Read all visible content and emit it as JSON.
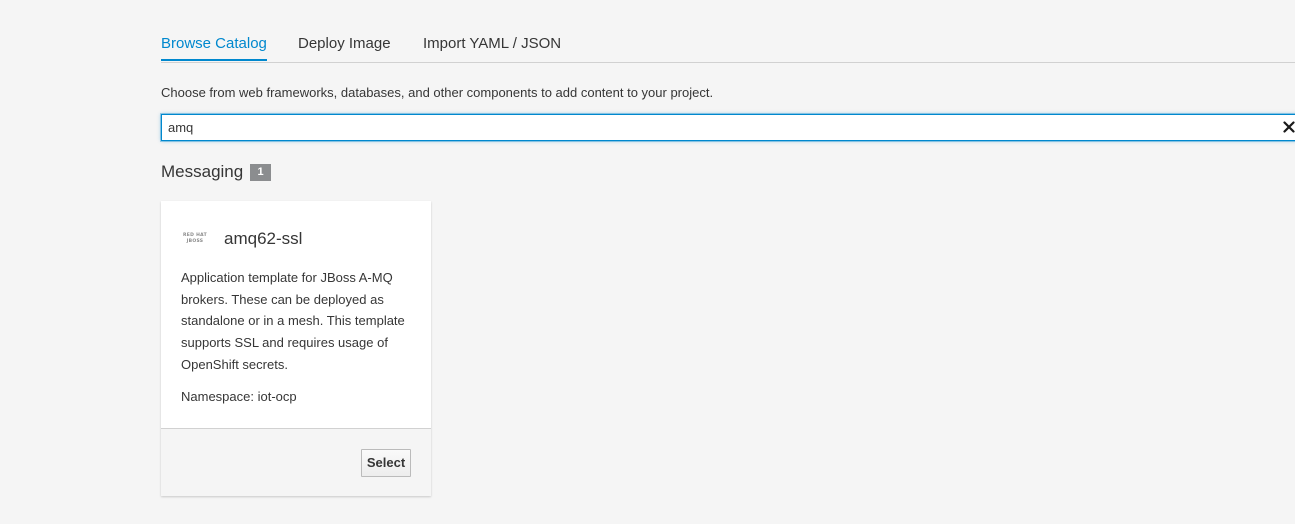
{
  "tabs": [
    {
      "label": "Browse Catalog",
      "active": true
    },
    {
      "label": "Deploy Image",
      "active": false
    },
    {
      "label": "Import YAML / JSON",
      "active": false
    }
  ],
  "help_text": "Choose from web frameworks, databases, and other components to add content to your project.",
  "search": {
    "value": "amq",
    "clear_icon": "close-icon"
  },
  "section": {
    "title": "Messaging",
    "count": "1"
  },
  "card": {
    "logo_lines": [
      "RED HAT",
      "JBOSS"
    ],
    "title": "amq62-ssl",
    "description": "Application template for JBoss A-MQ brokers. These can be deployed as standalone or in a mesh. This template supports SSL and requires usage of OpenShift secrets.",
    "namespace": "Namespace: iot-ocp",
    "select_label": "Select"
  },
  "colors": {
    "accent": "#0088ce",
    "badge": "#8b8d8f",
    "background": "#f5f5f5"
  }
}
